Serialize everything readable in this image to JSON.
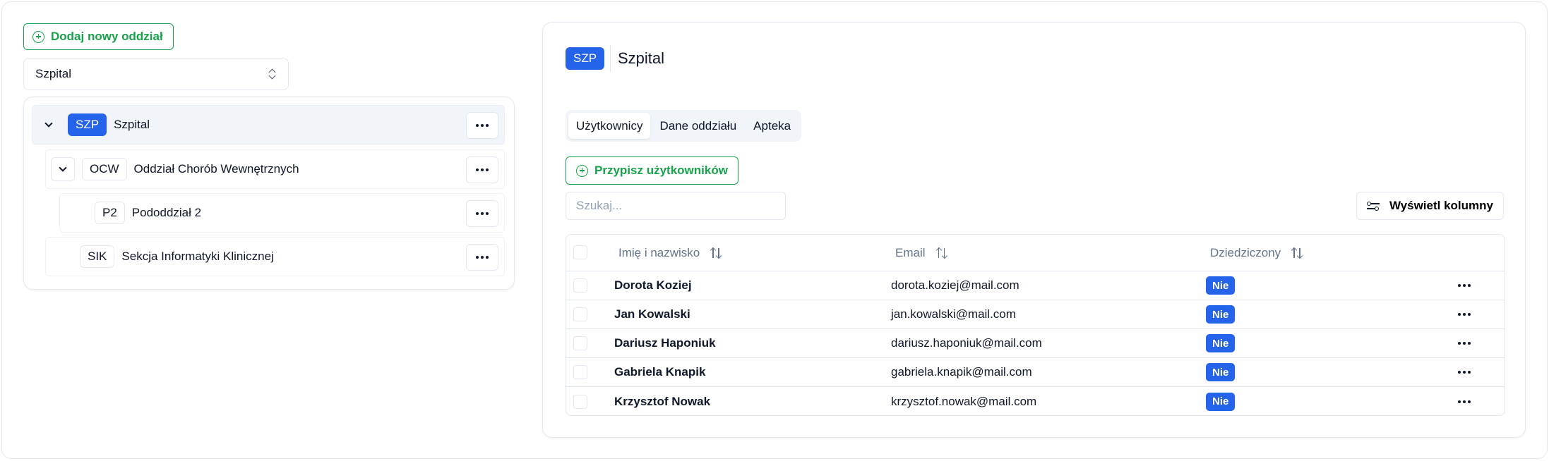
{
  "left": {
    "add_button": "Dodaj nowy oddział",
    "select_value": "Szpital",
    "tree": [
      {
        "code": "SZP",
        "label": "Szpital"
      },
      {
        "code": "OCW",
        "label": "Oddział Chorób Wewnętrznych"
      },
      {
        "code": "P2",
        "label": "Pododdział 2"
      },
      {
        "code": "SIK",
        "label": "Sekcja Informatyki Klinicznej"
      }
    ]
  },
  "right": {
    "header": {
      "code": "SZP",
      "title": "Szpital"
    },
    "tabs": [
      {
        "label": "Użytkownicy",
        "active": true
      },
      {
        "label": "Dane oddziału",
        "active": false
      },
      {
        "label": "Apteka",
        "active": false
      }
    ],
    "assign_button": "Przypisz użytkowników",
    "search_placeholder": "Szukaj...",
    "columns_button": "Wyświetl kolumny",
    "table": {
      "headers": {
        "name": "Imię i nazwisko",
        "email": "Email",
        "inherited": "Dziedziczony"
      },
      "rows": [
        {
          "name": "Dorota Koziej",
          "email": "dorota.koziej@mail.com",
          "inherited": "Nie"
        },
        {
          "name": "Jan Kowalski",
          "email": "jan.kowalski@mail.com",
          "inherited": "Nie"
        },
        {
          "name": "Dariusz Haponiuk",
          "email": "dariusz.haponiuk@mail.com",
          "inherited": "Nie"
        },
        {
          "name": "Gabriela Knapik",
          "email": "gabriela.knapik@mail.com",
          "inherited": "Nie"
        },
        {
          "name": "Krzysztof Nowak",
          "email": "krzysztof.nowak@mail.com",
          "inherited": "Nie"
        }
      ]
    }
  },
  "colors": {
    "accent": "#2563eb",
    "success": "#16a34a",
    "border": "#e2e8f0",
    "muted": "#64748b"
  }
}
